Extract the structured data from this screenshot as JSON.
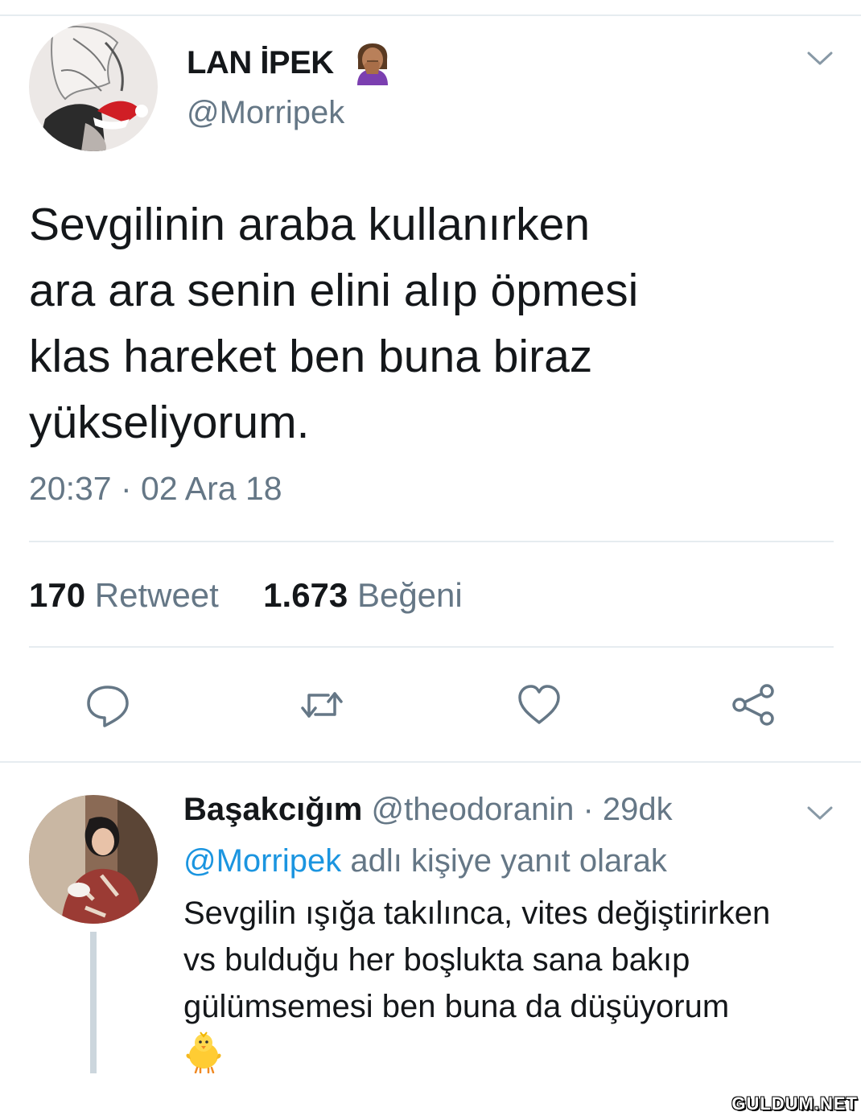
{
  "tweet": {
    "author_name": "LAN İPEK",
    "name_emoji": "face-palm-emoji",
    "handle": "@Morripek",
    "text_lines": [
      "Sevgilinin araba kullanırken",
      "ara ara senin elini alıp öpmesi",
      "klas hareket ben buna biraz",
      "yükseliyorum."
    ],
    "timestamp": "20:37 · 02 Ara 18",
    "retweet_count": "170",
    "retweet_label": "Retweet",
    "like_count": "1.673",
    "like_label": "Beğeni",
    "actions": [
      "reply-icon",
      "retweet-icon",
      "heart-icon",
      "share-icon"
    ]
  },
  "reply": {
    "author_name": "Başakcığım",
    "handle": "@theodoranin",
    "time_ago": "· 29dk",
    "reply_to_mention": "@Morripek",
    "reply_to_text": "adlı kişiye yanıt olarak",
    "text_lines": [
      "Sevgilin ışığa takılınca, vites değiştirirken",
      "vs bulduğu her boşlukta sana bakıp",
      "gülümsemesi ben buna da düşüyorum"
    ],
    "emoji": "baby-chick-emoji"
  },
  "watermark": "GULDUM.NET",
  "colors": {
    "text": "#14171a",
    "secondary": "#657786",
    "link": "#1b95e0",
    "divider": "#e6ecf0",
    "thread_line": "#ccd6dd"
  }
}
